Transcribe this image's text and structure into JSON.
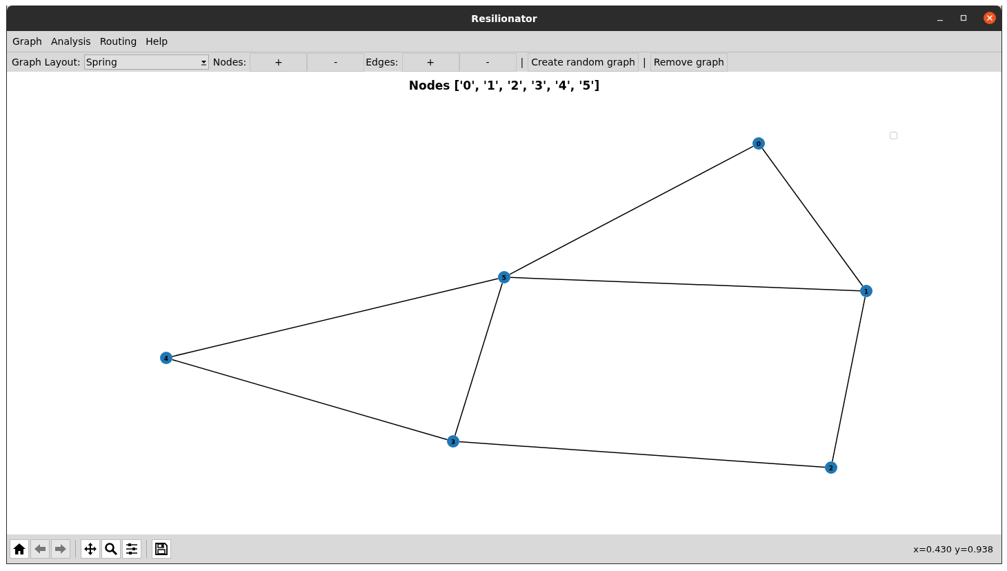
{
  "window": {
    "title": "Resilionator"
  },
  "menu": [
    "Graph",
    "Analysis",
    "Routing",
    "Help"
  ],
  "toolbar": {
    "layout_label": "Graph Layout:",
    "layout_value": "Spring",
    "nodes_label": "Nodes:",
    "nodes_add": "+",
    "nodes_remove": "-",
    "edges_label": "Edges:",
    "edges_add": "+",
    "edges_remove": "-",
    "separators": [
      "|",
      "|"
    ],
    "create_button": "Create random graph",
    "remove_button": "Remove graph"
  },
  "plot": {
    "title": "Nodes ['0', '1', '2', '3', '4', '5']",
    "nodes": [
      {
        "label": "0"
      },
      {
        "label": "1"
      },
      {
        "label": "2"
      },
      {
        "label": "3"
      },
      {
        "label": "4"
      },
      {
        "label": "5"
      }
    ]
  },
  "nav_tools": [
    {
      "kind": "home",
      "disabled": false
    },
    {
      "kind": "back",
      "disabled": true
    },
    {
      "kind": "forward",
      "disabled": true
    },
    {
      "kind": "sep"
    },
    {
      "kind": "pan",
      "disabled": false
    },
    {
      "kind": "zoom",
      "disabled": false
    },
    {
      "kind": "configure",
      "disabled": false
    },
    {
      "kind": "sep"
    },
    {
      "kind": "save",
      "disabled": false
    }
  ],
  "status": "x=0.430 y=0.938"
}
